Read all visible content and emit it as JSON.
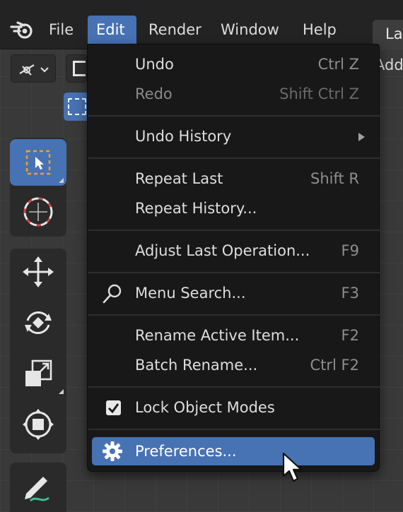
{
  "menubar": {
    "items": [
      {
        "label": "File"
      },
      {
        "label": "Edit"
      },
      {
        "label": "Render"
      },
      {
        "label": "Window"
      },
      {
        "label": "Help"
      }
    ],
    "workspace_tab": "La",
    "add_label": "Add"
  },
  "edit_menu": {
    "undo": {
      "label": "Undo",
      "shortcut": "Ctrl Z"
    },
    "redo": {
      "label": "Redo",
      "shortcut": "Shift Ctrl Z"
    },
    "undo_history": {
      "label": "Undo History"
    },
    "repeat_last": {
      "label": "Repeat Last",
      "shortcut": "Shift R"
    },
    "repeat_history": {
      "label": "Repeat History..."
    },
    "adjust_last": {
      "label": "Adjust Last Operation...",
      "shortcut": "F9"
    },
    "menu_search": {
      "label": "Menu Search...",
      "shortcut": "F3"
    },
    "rename_active": {
      "label": "Rename Active Item...",
      "shortcut": "F2"
    },
    "batch_rename": {
      "label": "Batch Rename...",
      "shortcut": "Ctrl F2"
    },
    "lock_object_modes": {
      "label": "Lock Object Modes",
      "checked": true
    },
    "preferences": {
      "label": "Preferences..."
    }
  },
  "colors": {
    "accent": "#4772b3",
    "menu_bg": "#181818",
    "menubar_bg": "#232323"
  }
}
